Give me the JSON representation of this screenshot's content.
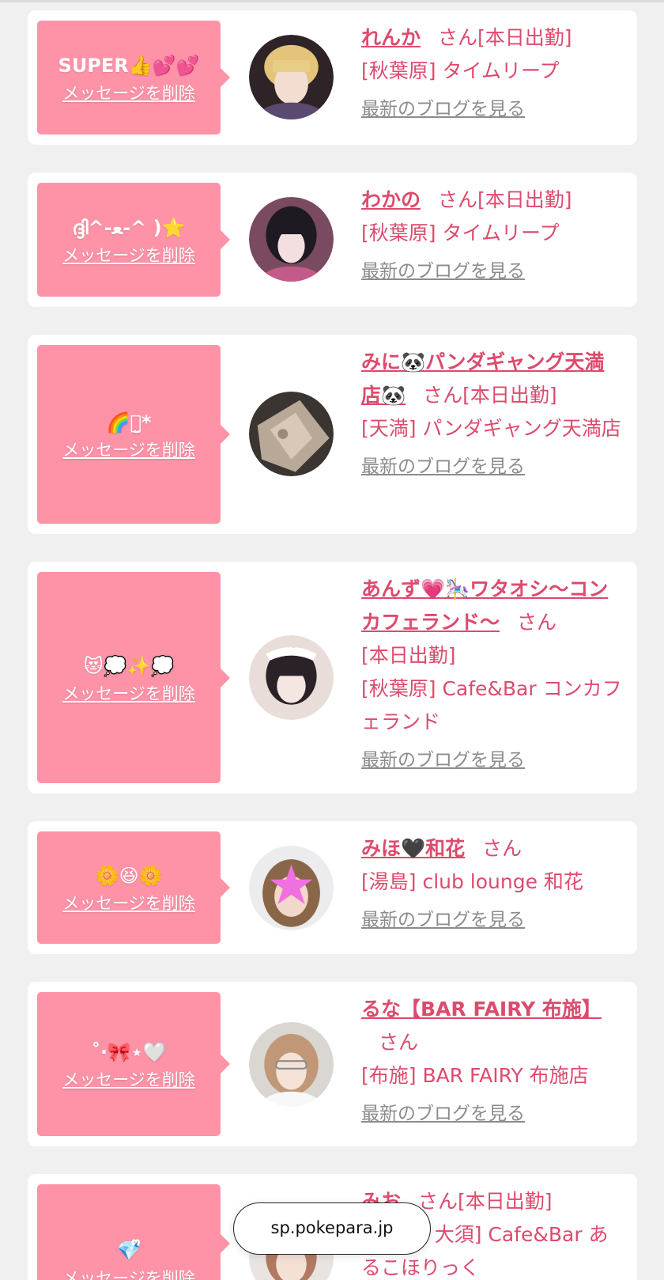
{
  "cards": [
    {
      "message": "SUPER👍💕💕",
      "delete_label": "メッセージを削除",
      "name": "れんか",
      "san": "さん",
      "shift": "[本日出勤]",
      "location": "[秋葉原] タイムリープ",
      "blog_label": "最新のブログを見る"
    },
    {
      "message": "ദ്ദി^-ﻌ-^ )⭐️",
      "delete_label": "メッセージを削除",
      "name": "わかの",
      "san": "さん",
      "shift": "[本日出勤]",
      "location": "[秋葉原] タイムリープ",
      "blog_label": "最新のブログを見る"
    },
    {
      "message": "🌈ꪔ̤̮*",
      "delete_label": "メッセージを削除",
      "name": "みに🐼パンダギャング天満店🐼",
      "san": "さん",
      "shift": "[本日出勤]",
      "location": "[天満] パンダギャング天満店",
      "blog_label": "最新のブログを見る"
    },
    {
      "message": "😻💭✨💭",
      "delete_label": "メッセージを削除",
      "name": "あんず💗🎠ワタオシ〜コンカフェランド〜",
      "san": "さん",
      "shift": "[本日出勤]",
      "location": "[秋葉原] Cafe&Bar コンカフェランド",
      "blog_label": "最新のブログを見る"
    },
    {
      "message": "🌼😆🌼",
      "delete_label": "メッセージを削除",
      "name": "みほ🖤和花",
      "san": "さん",
      "shift": "",
      "location": "[湯島] club lounge 和花",
      "blog_label": "最新のブログを見る"
    },
    {
      "message": "˚‧🎀⋆🤍",
      "delete_label": "メッセージを削除",
      "name": "るな【BAR FAIRY 布施】",
      "san": "さん",
      "shift": "",
      "location": "[布施] BAR FAIRY 布施店",
      "blog_label": "最新のブログを見る"
    },
    {
      "message": "💎ᩚ ",
      "delete_label": "メッセージを削除",
      "name": "みお",
      "san": "さん",
      "shift": "[本日出勤]",
      "location": "[名古屋 大須] Cafe&Bar あるこほりっく",
      "blog_label": ""
    }
  ],
  "url_bar": {
    "text": "sp.pokepara.jp"
  }
}
